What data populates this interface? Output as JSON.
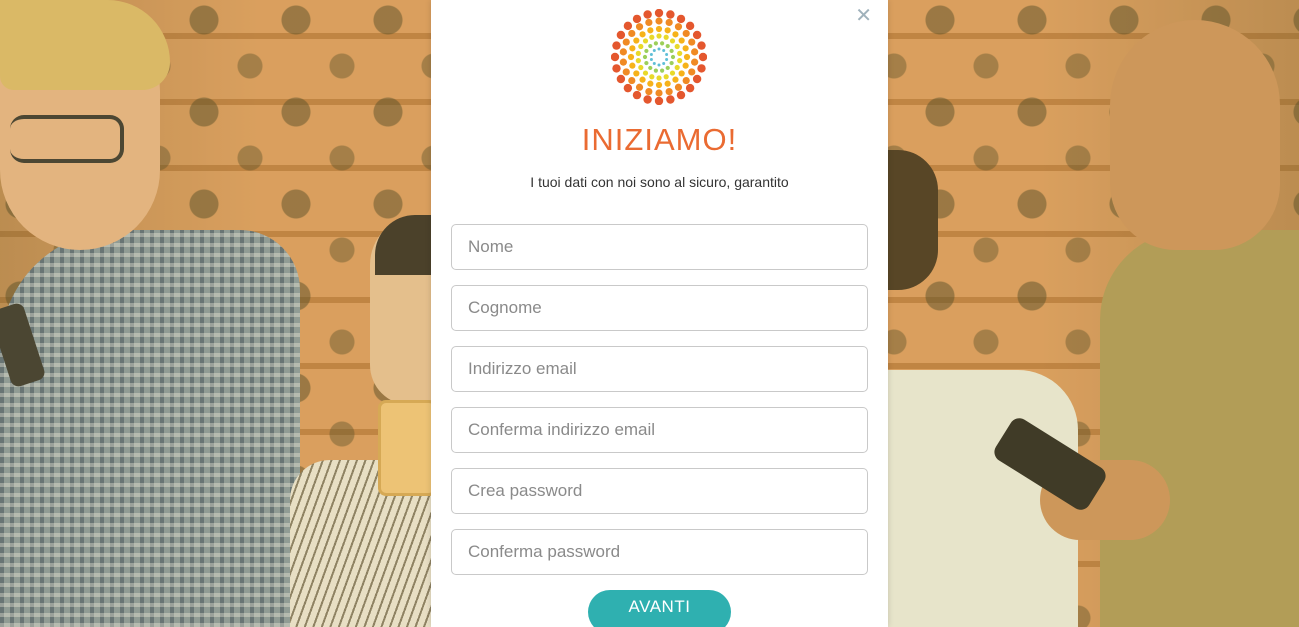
{
  "modal": {
    "close_label": "✕",
    "title": "INIZIAMO!",
    "subtitle": "I tuoi dati con noi sono al sicuro, garantito",
    "fields": [
      {
        "placeholder": "Nome",
        "value": ""
      },
      {
        "placeholder": "Cognome",
        "value": ""
      },
      {
        "placeholder": "Indirizzo email",
        "value": ""
      },
      {
        "placeholder": "Conferma indirizzo email",
        "value": ""
      },
      {
        "placeholder": "Crea password",
        "value": ""
      },
      {
        "placeholder": "Conferma password",
        "value": ""
      }
    ],
    "submit_label": "AVANTI"
  },
  "icons": {
    "logo": "sunburst-dots-logo-icon",
    "close": "close-icon"
  },
  "colors": {
    "accent_orange": "#ea6b32",
    "button_teal": "#2fb0b0",
    "close_gray": "#9fb1bb",
    "logo_dots": [
      "#e4572e",
      "#f08a24",
      "#f6b21a",
      "#e8d92a",
      "#9ccf5a",
      "#5fbfd6"
    ]
  }
}
